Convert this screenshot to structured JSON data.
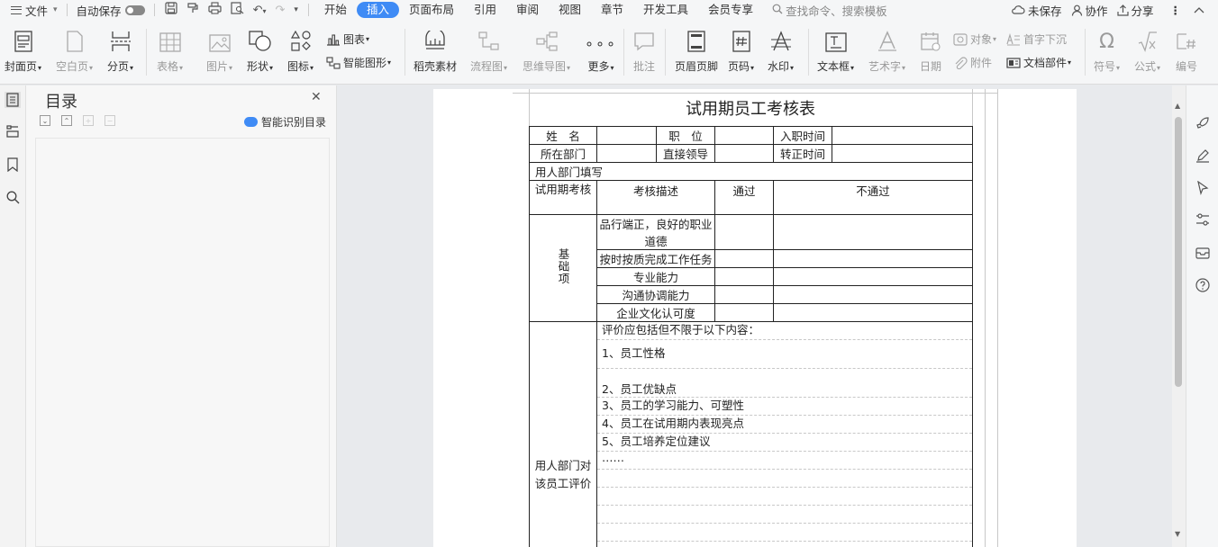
{
  "menubar": {
    "file": "文件",
    "autosave": "自动保存",
    "tabs": [
      "开始",
      "插入",
      "页面布局",
      "引用",
      "审阅",
      "视图",
      "章节",
      "开发工具",
      "会员专享"
    ],
    "search_placeholder": "查找命令、搜索模板",
    "unsaved": "未保存",
    "collab": "协作",
    "share": "分享"
  },
  "ribbon": {
    "cover": "封面页",
    "blank": "空白页",
    "break": "分页",
    "table": "表格",
    "picture": "图片",
    "shape": "形状",
    "icon": "图标",
    "chart": "图表",
    "smartart": "智能图形",
    "material": "稻壳素材",
    "flowchart": "流程图",
    "mindmap": "思维导图",
    "more": "更多",
    "comment": "批注",
    "headerfooter": "页眉页脚",
    "pagenum": "页码",
    "watermark": "水印",
    "textbox": "文本框",
    "wordart": "艺术字",
    "date": "日期",
    "object": "对象",
    "attachment": "附件",
    "dropcap": "首字下沉",
    "docparts": "文档部件",
    "symbol": "符号",
    "formula": "公式",
    "numbering": "编号"
  },
  "toc": {
    "title": "目录",
    "smart": "智能识别目录"
  },
  "document": {
    "title": "试用期员工考核表",
    "name_label": "姓　名",
    "position_label": "职　位",
    "hire_label": "入职时间",
    "dept_label": "所在部门",
    "supervisor_label": "直接领导",
    "confirm_label": "转正时间",
    "fill_by": "用人部门填写",
    "probation_label": "试用期考核",
    "desc_label": "考核描述",
    "pass_label": "通过",
    "fail_label": "不通过",
    "basic_label": "基础项",
    "items": [
      "品行端正，良好的职业道德",
      "按时按质完成工作任务",
      "专业能力",
      "沟通协调能力",
      "企业文化认可度"
    ],
    "eval_label": "用人部门对该员工评价",
    "eval_lines": [
      "评价应包括但不限于以下内容：",
      "1、员工性格",
      "2、员工优缺点",
      "3、员工的学习能力、可塑性",
      "4、员工在试用期内表现亮点",
      "5、员工培养定位建议",
      "……"
    ]
  }
}
